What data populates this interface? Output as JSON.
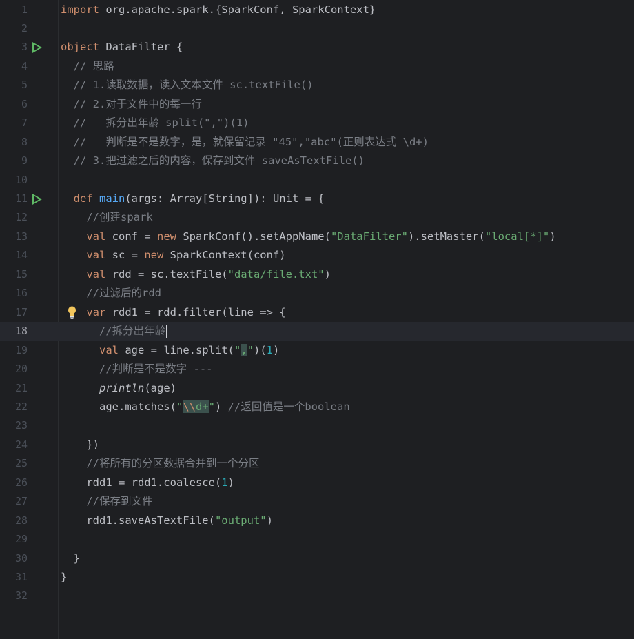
{
  "editor": {
    "current_line": 18,
    "lines": [
      {
        "n": "1",
        "tokens": [
          {
            "t": "import ",
            "c": "kw"
          },
          {
            "t": "org.apache.spark.{SparkConf, SparkContext}"
          }
        ]
      },
      {
        "n": "2",
        "tokens": []
      },
      {
        "n": "3",
        "run": true,
        "tokens": [
          {
            "t": "object ",
            "c": "kw"
          },
          {
            "t": "DataFilter {"
          }
        ]
      },
      {
        "n": "4",
        "tokens": [
          {
            "t": "  // 思路",
            "c": "cmt"
          }
        ]
      },
      {
        "n": "5",
        "tokens": [
          {
            "t": "  // 1.读取数据，读入文本文件 sc.textFile()",
            "c": "cmt"
          }
        ]
      },
      {
        "n": "6",
        "tokens": [
          {
            "t": "  // 2.对于文件中的每一行",
            "c": "cmt"
          }
        ]
      },
      {
        "n": "7",
        "tokens": [
          {
            "t": "  //   拆分出年龄 split(\",\")(1)",
            "c": "cmt"
          }
        ]
      },
      {
        "n": "8",
        "tokens": [
          {
            "t": "  //   判断是不是数字，是，就保留记录 \"45\",\"abc\"(正则表达式 \\d+)",
            "c": "cmt"
          }
        ]
      },
      {
        "n": "9",
        "tokens": [
          {
            "t": "  // 3.把过滤之后的内容，保存到文件 saveAsTextFile()",
            "c": "cmt"
          }
        ]
      },
      {
        "n": "10",
        "tokens": []
      },
      {
        "n": "11",
        "run": true,
        "tokens": [
          {
            "t": "  "
          },
          {
            "t": "def ",
            "c": "kw"
          },
          {
            "t": "main",
            "c": "fn"
          },
          {
            "t": "(args: Array[String]): Unit = {"
          }
        ]
      },
      {
        "n": "12",
        "tokens": [
          {
            "t": "    //创建spark",
            "c": "cmt"
          }
        ]
      },
      {
        "n": "13",
        "tokens": [
          {
            "t": "    "
          },
          {
            "t": "val ",
            "c": "kw"
          },
          {
            "t": "conf = "
          },
          {
            "t": "new ",
            "c": "kw"
          },
          {
            "t": "SparkConf().setAppName("
          },
          {
            "t": "\"DataFilter\"",
            "c": "str"
          },
          {
            "t": ").setMaster("
          },
          {
            "t": "\"local[*]\"",
            "c": "str"
          },
          {
            "t": ")"
          }
        ]
      },
      {
        "n": "14",
        "tokens": [
          {
            "t": "    "
          },
          {
            "t": "val ",
            "c": "kw"
          },
          {
            "t": "sc = "
          },
          {
            "t": "new ",
            "c": "kw"
          },
          {
            "t": "SparkContext(conf)"
          }
        ]
      },
      {
        "n": "15",
        "tokens": [
          {
            "t": "    "
          },
          {
            "t": "val ",
            "c": "kw"
          },
          {
            "t": "rdd = sc.textFile("
          },
          {
            "t": "\"data/file.txt\"",
            "c": "str"
          },
          {
            "t": ")"
          }
        ]
      },
      {
        "n": "16",
        "tokens": [
          {
            "t": "    //过滤后的rdd",
            "c": "cmt"
          }
        ]
      },
      {
        "n": "17",
        "bulb": true,
        "tokens": [
          {
            "t": "    "
          },
          {
            "t": "var ",
            "c": "kw"
          },
          {
            "t": "rdd1 = rdd.filter(line => {"
          }
        ]
      },
      {
        "n": "18",
        "caret": true,
        "tokens": [
          {
            "t": "      //拆分出年龄",
            "c": "cmt"
          }
        ]
      },
      {
        "n": "19",
        "tokens": [
          {
            "t": "      "
          },
          {
            "t": "val ",
            "c": "kw"
          },
          {
            "t": "age = line.split("
          },
          {
            "t": "\"",
            "c": "str"
          },
          {
            "t": ",",
            "c": "str hl"
          },
          {
            "t": "\"",
            "c": "str"
          },
          {
            "t": ")("
          },
          {
            "t": "1",
            "c": "num"
          },
          {
            "t": ")"
          }
        ]
      },
      {
        "n": "20",
        "tokens": [
          {
            "t": "      //判断是不是数字 ---",
            "c": "cmt"
          }
        ]
      },
      {
        "n": "21",
        "tokens": [
          {
            "t": "      "
          },
          {
            "t": "println",
            "c": "it"
          },
          {
            "t": "(age)"
          }
        ]
      },
      {
        "n": "22",
        "tokens": [
          {
            "t": "      age.matches("
          },
          {
            "t": "\"",
            "c": "str"
          },
          {
            "t": "\\\\",
            "c": "esc hl"
          },
          {
            "t": "d+",
            "c": "str hl"
          },
          {
            "t": "\"",
            "c": "str"
          },
          {
            "t": ") "
          },
          {
            "t": "//返回值是一个boolean",
            "c": "cmt"
          }
        ]
      },
      {
        "n": "23",
        "tokens": []
      },
      {
        "n": "24",
        "tokens": [
          {
            "t": "    })"
          }
        ]
      },
      {
        "n": "25",
        "tokens": [
          {
            "t": "    //将所有的分区数据合并到一个分区",
            "c": "cmt"
          }
        ]
      },
      {
        "n": "26",
        "tokens": [
          {
            "t": "    rdd1 = rdd1.coalesce("
          },
          {
            "t": "1",
            "c": "num"
          },
          {
            "t": ")"
          }
        ]
      },
      {
        "n": "27",
        "tokens": [
          {
            "t": "    //保存到文件",
            "c": "cmt"
          }
        ]
      },
      {
        "n": "28",
        "tokens": [
          {
            "t": "    rdd1.saveAsTextFile("
          },
          {
            "t": "\"output\"",
            "c": "str"
          },
          {
            "t": ")"
          }
        ]
      },
      {
        "n": "29",
        "tokens": []
      },
      {
        "n": "30",
        "tokens": [
          {
            "t": "  }"
          }
        ]
      },
      {
        "n": "31",
        "tokens": [
          {
            "t": "}"
          }
        ]
      },
      {
        "n": "32",
        "tokens": []
      }
    ]
  }
}
